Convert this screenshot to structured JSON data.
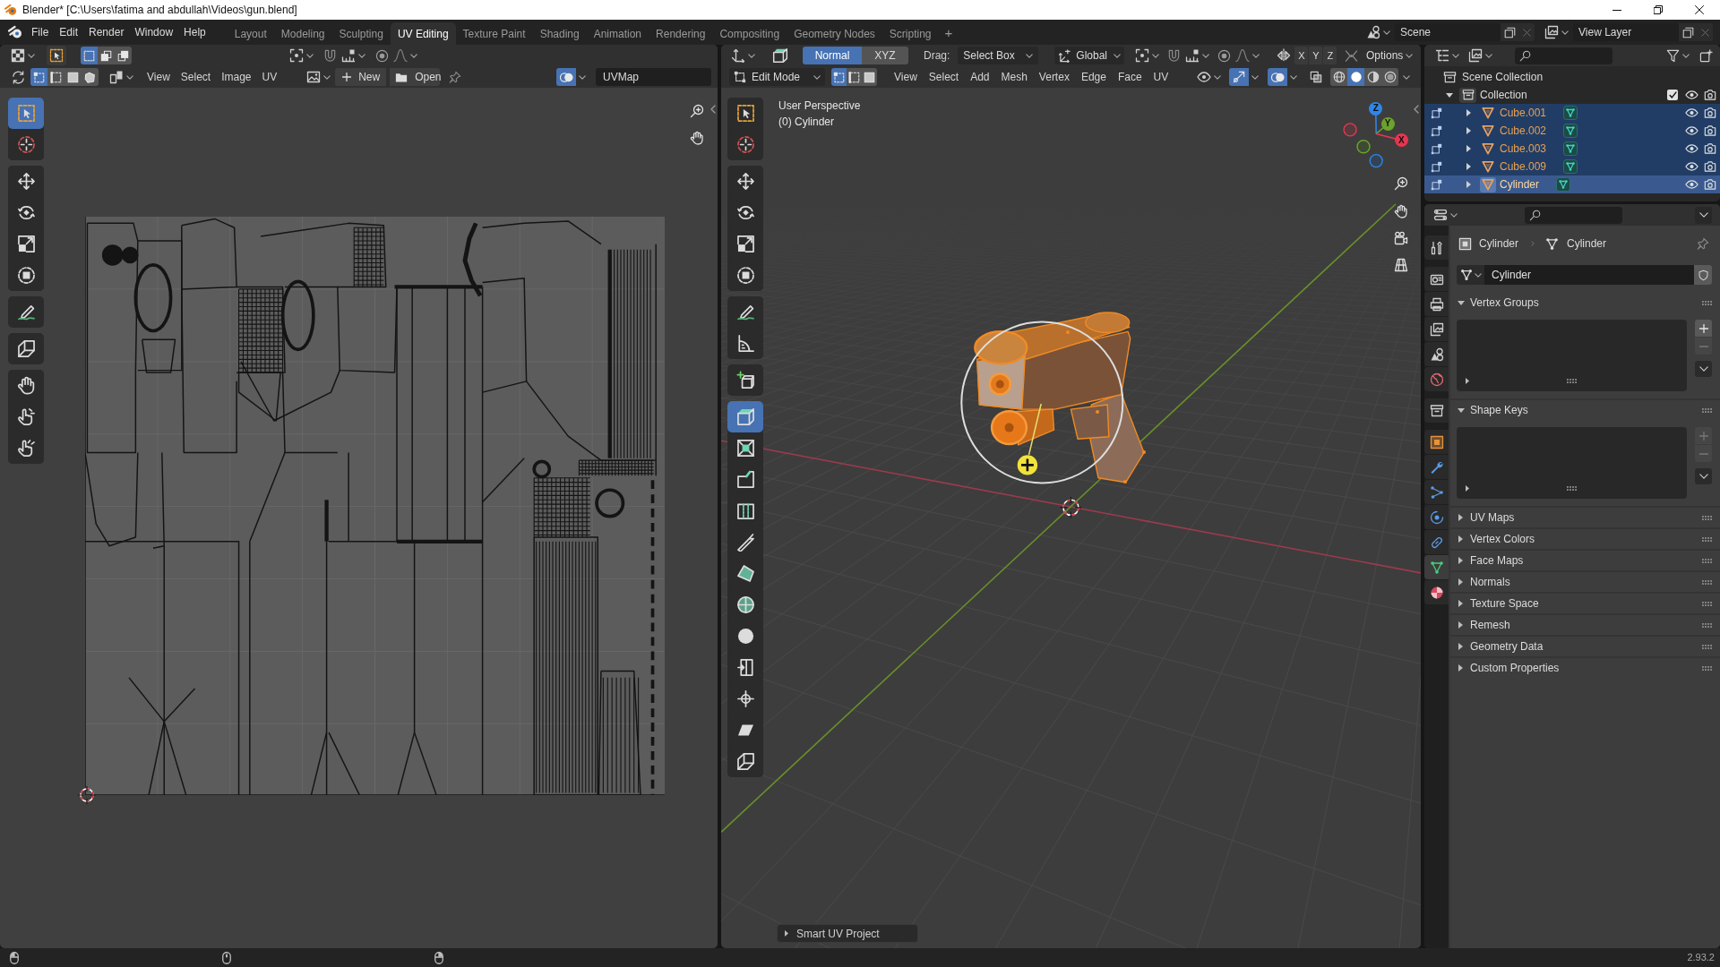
{
  "window": {
    "title": "Blender* [C:\\Users\\fatima and abdullah\\Videos\\gun.blend]"
  },
  "top_bar": {
    "menus": [
      "File",
      "Edit",
      "Render",
      "Window",
      "Help"
    ],
    "workspaces": [
      {
        "label": "Layout",
        "selected": false
      },
      {
        "label": "Modeling",
        "selected": false
      },
      {
        "label": "Sculpting",
        "selected": false
      },
      {
        "label": "UV Editing",
        "selected": true
      },
      {
        "label": "Texture Paint",
        "selected": false
      },
      {
        "label": "Shading",
        "selected": false
      },
      {
        "label": "Animation",
        "selected": false
      },
      {
        "label": "Rendering",
        "selected": false
      },
      {
        "label": "Compositing",
        "selected": false
      },
      {
        "label": "Geometry Nodes",
        "selected": false
      },
      {
        "label": "Scripting",
        "selected": false
      }
    ],
    "add_workspace": "+",
    "scene": "Scene",
    "view_layer": "View Layer"
  },
  "uv_editor": {
    "box_modes": [
      {
        "kind": "new",
        "selected": true
      },
      {
        "kind": "extend",
        "selected": false
      },
      {
        "kind": "subtract",
        "selected": false
      }
    ],
    "select_modes": [
      {
        "kind": "vertex",
        "selected": true
      },
      {
        "kind": "edge",
        "selected": false
      },
      {
        "kind": "face",
        "selected": false
      },
      {
        "kind": "island",
        "selected": false
      }
    ],
    "menus": [
      "View",
      "Select",
      "Image",
      "UV"
    ],
    "new_button": "New",
    "open_button": "Open",
    "overlays_on": true,
    "uv_map": "UVMap",
    "tool_groups": [
      [
        {
          "kind": "select-box",
          "selected": true
        },
        {
          "kind": "cursor",
          "selected": false
        }
      ],
      [
        {
          "kind": "move",
          "selected": false
        },
        {
          "kind": "rotate",
          "selected": false
        },
        {
          "kind": "scale",
          "selected": false
        },
        {
          "kind": "transform",
          "selected": false
        }
      ],
      [
        {
          "kind": "annotate",
          "selected": false
        }
      ],
      [
        {
          "kind": "rip",
          "selected": false
        }
      ],
      [
        {
          "kind": "grab",
          "selected": false
        },
        {
          "kind": "relax",
          "selected": false
        },
        {
          "kind": "pinch",
          "selected": false
        }
      ]
    ]
  },
  "viewport": {
    "orientation_options": [
      {
        "label": "Normal",
        "selected": true
      },
      {
        "label": "XYZ",
        "selected": false
      }
    ],
    "drag_label": "Drag:",
    "drag_value": "Select Box",
    "transform_orientation": "Global",
    "mirror_axes": [
      "X",
      "Y",
      "Z"
    ],
    "options": "Options",
    "mode": "Edit Mode",
    "select_modes": [
      {
        "kind": "vertex",
        "selected": true
      },
      {
        "kind": "edge",
        "selected": false
      },
      {
        "kind": "face",
        "selected": false
      }
    ],
    "menus": [
      "View",
      "Select",
      "Add",
      "Mesh",
      "Vertex",
      "Edge",
      "Face",
      "UV"
    ],
    "gizmos_on": true,
    "overlays_on": true,
    "xray_on": false,
    "shading_modes": [
      {
        "kind": "wireframe",
        "selected": false
      },
      {
        "kind": "solid",
        "selected": true
      },
      {
        "kind": "material",
        "selected": false
      },
      {
        "kind": "rendered",
        "selected": false
      }
    ],
    "view_name": "User Perspective",
    "object_label": "(0) Cylinder",
    "nav_axes": [
      {
        "label": "Z",
        "color": "#2e86e8"
      },
      {
        "label": "Y",
        "color": "#6ca32d"
      },
      {
        "label": "X",
        "color": "#e8354f"
      }
    ],
    "tool_groups": [
      [
        {
          "kind": "select-box",
          "selected": false
        },
        {
          "kind": "cursor",
          "selected": false
        }
      ],
      [
        {
          "kind": "move",
          "selected": false
        },
        {
          "kind": "rotate",
          "selected": false
        },
        {
          "kind": "scale",
          "selected": false
        },
        {
          "kind": "transform",
          "selected": false
        }
      ],
      [
        {
          "kind": "annotate",
          "selected": false
        },
        {
          "kind": "measure",
          "selected": false
        }
      ],
      [
        {
          "kind": "add-cube",
          "selected": false
        }
      ],
      [
        {
          "kind": "extrude",
          "selected": true
        },
        {
          "kind": "inset",
          "selected": false
        },
        {
          "kind": "bevel",
          "selected": false
        },
        {
          "kind": "loop-cut",
          "selected": false
        },
        {
          "kind": "knife",
          "selected": false
        },
        {
          "kind": "poly-build",
          "selected": false
        },
        {
          "kind": "spin",
          "selected": false
        },
        {
          "kind": "smooth",
          "selected": false
        },
        {
          "kind": "edge-slide",
          "selected": false
        },
        {
          "kind": "shrink-fatten",
          "selected": false
        },
        {
          "kind": "shear",
          "selected": false
        },
        {
          "kind": "rip-region",
          "selected": false
        }
      ]
    ],
    "last_operator": "Smart UV Project"
  },
  "outliner": {
    "root": "Scene Collection",
    "collection": {
      "name": "Collection",
      "expanded": true,
      "checked": true,
      "children": [
        {
          "name": "Cube.001",
          "expanded": false,
          "selected": true,
          "active": false
        },
        {
          "name": "Cube.002",
          "expanded": false,
          "selected": true,
          "active": false
        },
        {
          "name": "Cube.003",
          "expanded": false,
          "selected": true,
          "active": false
        },
        {
          "name": "Cube.009",
          "expanded": false,
          "selected": true,
          "active": false
        },
        {
          "name": "Cylinder",
          "expanded": false,
          "selected": true,
          "active": true
        }
      ]
    }
  },
  "properties": {
    "tab_groups": [
      [
        {
          "kind": "tool",
          "selected": false
        }
      ],
      [
        {
          "kind": "render",
          "selected": false
        },
        {
          "kind": "output",
          "selected": false
        },
        {
          "kind": "view_layer",
          "selected": false
        },
        {
          "kind": "scene",
          "selected": false
        },
        {
          "kind": "world",
          "selected": false
        }
      ],
      [
        {
          "kind": "collection",
          "selected": false
        }
      ],
      [
        {
          "kind": "object",
          "selected": false
        },
        {
          "kind": "modifiers",
          "selected": false
        },
        {
          "kind": "particles",
          "selected": false
        },
        {
          "kind": "physics",
          "selected": false
        },
        {
          "kind": "constraints",
          "selected": false
        },
        {
          "kind": "data",
          "selected": true
        },
        {
          "kind": "material",
          "selected": false
        }
      ]
    ],
    "breadcrumb": [
      "Cylinder",
      "Cylinder"
    ],
    "mesh_name": "Cylinder",
    "panels": [
      {
        "title": "Vertex Groups",
        "expanded": true,
        "add_enabled": true,
        "remove_enabled": false
      },
      {
        "title": "Shape Keys",
        "expanded": true,
        "add_enabled": false,
        "remove_enabled": false
      },
      {
        "title": "UV Maps",
        "expanded": false
      },
      {
        "title": "Vertex Colors",
        "expanded": false
      },
      {
        "title": "Face Maps",
        "expanded": false
      },
      {
        "title": "Normals",
        "expanded": false
      },
      {
        "title": "Texture Space",
        "expanded": false
      },
      {
        "title": "Remesh",
        "expanded": false
      },
      {
        "title": "Geometry Data",
        "expanded": false
      },
      {
        "title": "Custom Properties",
        "expanded": false
      }
    ]
  },
  "status_bar": {
    "version": "2.93.2"
  }
}
